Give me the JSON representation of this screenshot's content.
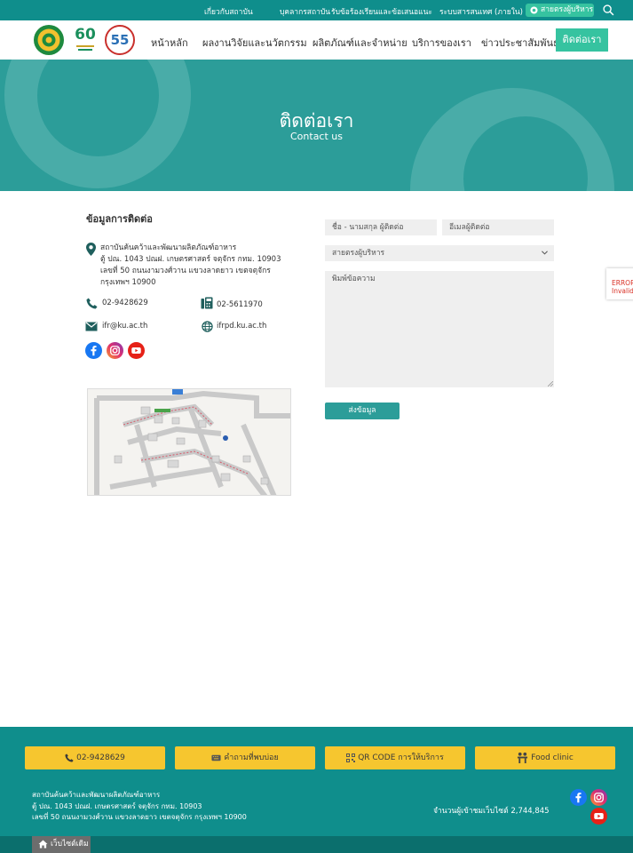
{
  "topbar": {
    "links": [
      "เกี่ยวกับสถาบัน",
      "บุคลากรสถาบัน",
      "รับข้อร้องเรียนและข้อเสนอแนะ",
      "ระบบสารสนเทศ (ภายใน)"
    ],
    "hotline_label": "สายตรงผู้บริหาร"
  },
  "header": {
    "logo_60_text": "60",
    "logo_55_text": "55",
    "nav": [
      "หน้าหลัก",
      "ผลงานวิจัยและนวัตกรรม",
      "ผลิตภัณฑ์และจำหน่าย",
      "บริการของเรา",
      "ข่าวประชาสัมพันธ์"
    ],
    "nav_active": "ติดต่อเรา"
  },
  "hero": {
    "title": "ติดต่อเรา",
    "subtitle": "Contact us"
  },
  "contact": {
    "title": "ข้อมูลการติดต่อ",
    "address_lines": [
      "สถาบันค้นคว้าและพัฒนาผลิตภัณฑ์อาหาร",
      "ตู้ ปณ. 1043 ปณฝ. เกษตรศาสตร์ จตุจักร กทม. 10903",
      "เลขที่ 50 ถนนงามวงศ์วาน แขวงลาดยาว เขตจตุจักร",
      "กรุงเทพฯ 10900"
    ],
    "phone": "02-9428629",
    "fax": "02-5611970",
    "email": "ifr@ku.ac.th",
    "website": "ifrpd.ku.ac.th"
  },
  "form": {
    "name_placeholder": "ชื่อ - นามสกุล ผู้ติดต่อ",
    "email_placeholder": "อีเมลผู้ติดต่อ",
    "select_value": "สายตรงผู้บริหาร",
    "message_placeholder": "พิมพ์ข้อความ",
    "submit_label": "ส่งข้อมูล"
  },
  "recaptcha": {
    "line1": "ERROR",
    "line2": "Invalid"
  },
  "footer": {
    "buttons": [
      "02-9428629",
      "คำถามที่พบบ่อย",
      "QR CODE การให้บริการ",
      "Food clinic"
    ],
    "address_lines": [
      "สถาบันค้นคว้าและพัฒนาผลิตภัณฑ์อาหาร",
      "ตู้ ปณ. 1043 ปณฝ. เกษตรศาสตร์ จตุจักร กทม. 10903",
      "เลขที่ 50 ถนนงามวงศ์วาน แขวงลาดยาว เขตจตุจักร กรุงเทพฯ 10900"
    ],
    "visitor_count": "จำนวนผู้เข้าชมเว็บไซต์ 2,744,845",
    "old_site_label": "เว็บไซต์เดิม"
  },
  "colors": {
    "teal_dark": "#0f8e8c",
    "teal_hero": "#2c9d99",
    "mint_accent": "#36c3a0",
    "yellow_button": "#f6c62f"
  },
  "icons": [
    "hotline-icon",
    "search-icon",
    "location-icon",
    "phone-icon",
    "fax-icon",
    "mail-icon",
    "globe-icon",
    "facebook-icon",
    "instagram-icon",
    "youtube-icon",
    "faq-icon",
    "qr-icon",
    "clinic-icon",
    "home-icon",
    "chevron-down-icon"
  ]
}
